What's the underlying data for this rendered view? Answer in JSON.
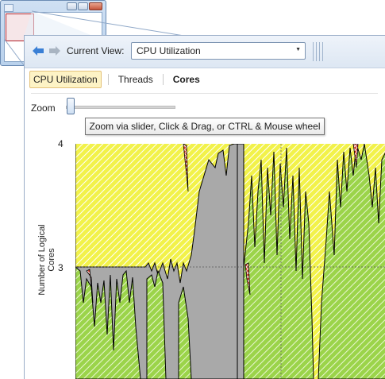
{
  "toolbar": {
    "current_view_label": "Current View:",
    "current_view_value": "CPU Utilization"
  },
  "tabs": [
    {
      "label": "CPU Utilization"
    },
    {
      "label": "Threads"
    },
    {
      "label": "Cores"
    }
  ],
  "zoom": {
    "label": "Zoom",
    "tooltip": "Zoom via slider, Click & Drag, or CTRL & Mouse wheel"
  },
  "chart_data": {
    "type": "area",
    "ylabel": "Number of Logical Cores",
    "yticks": [
      "4",
      "3"
    ],
    "ylim": [
      2,
      4
    ],
    "grid": true,
    "colors": {
      "yellow_hatch": "#f2f24a",
      "green_hatch": "#9bd44a",
      "gray": "#a9a9a9",
      "red_pattern": "#d43a2a",
      "outline": "#000000"
    }
  },
  "icons": {
    "back": "back-arrow-icon",
    "forward": "forward-arrow-icon",
    "dropdown": "chevron-down-icon"
  }
}
